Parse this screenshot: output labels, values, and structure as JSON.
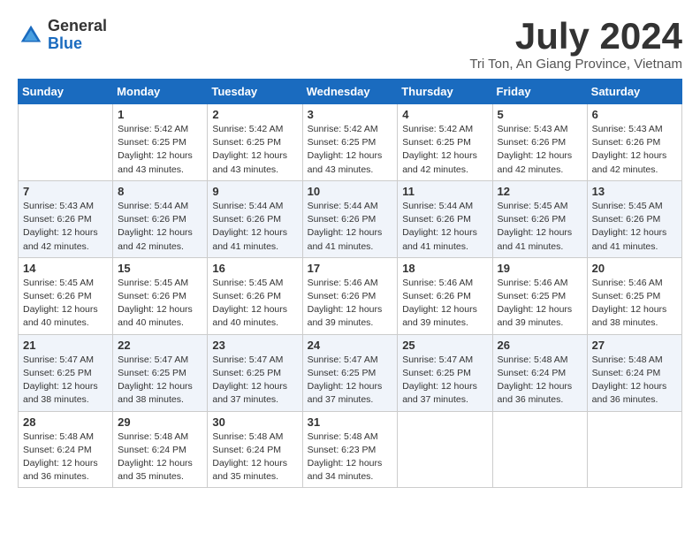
{
  "logo": {
    "general": "General",
    "blue": "Blue"
  },
  "header": {
    "month": "July 2024",
    "location": "Tri Ton, An Giang Province, Vietnam"
  },
  "days_of_week": [
    "Sunday",
    "Monday",
    "Tuesday",
    "Wednesday",
    "Thursday",
    "Friday",
    "Saturday"
  ],
  "weeks": [
    [
      {
        "day": "",
        "info": ""
      },
      {
        "day": "1",
        "info": "Sunrise: 5:42 AM\nSunset: 6:25 PM\nDaylight: 12 hours\nand 43 minutes."
      },
      {
        "day": "2",
        "info": "Sunrise: 5:42 AM\nSunset: 6:25 PM\nDaylight: 12 hours\nand 43 minutes."
      },
      {
        "day": "3",
        "info": "Sunrise: 5:42 AM\nSunset: 6:25 PM\nDaylight: 12 hours\nand 43 minutes."
      },
      {
        "day": "4",
        "info": "Sunrise: 5:42 AM\nSunset: 6:25 PM\nDaylight: 12 hours\nand 42 minutes."
      },
      {
        "day": "5",
        "info": "Sunrise: 5:43 AM\nSunset: 6:26 PM\nDaylight: 12 hours\nand 42 minutes."
      },
      {
        "day": "6",
        "info": "Sunrise: 5:43 AM\nSunset: 6:26 PM\nDaylight: 12 hours\nand 42 minutes."
      }
    ],
    [
      {
        "day": "7",
        "info": "Sunrise: 5:43 AM\nSunset: 6:26 PM\nDaylight: 12 hours\nand 42 minutes."
      },
      {
        "day": "8",
        "info": "Sunrise: 5:44 AM\nSunset: 6:26 PM\nDaylight: 12 hours\nand 42 minutes."
      },
      {
        "day": "9",
        "info": "Sunrise: 5:44 AM\nSunset: 6:26 PM\nDaylight: 12 hours\nand 41 minutes."
      },
      {
        "day": "10",
        "info": "Sunrise: 5:44 AM\nSunset: 6:26 PM\nDaylight: 12 hours\nand 41 minutes."
      },
      {
        "day": "11",
        "info": "Sunrise: 5:44 AM\nSunset: 6:26 PM\nDaylight: 12 hours\nand 41 minutes."
      },
      {
        "day": "12",
        "info": "Sunrise: 5:45 AM\nSunset: 6:26 PM\nDaylight: 12 hours\nand 41 minutes."
      },
      {
        "day": "13",
        "info": "Sunrise: 5:45 AM\nSunset: 6:26 PM\nDaylight: 12 hours\nand 41 minutes."
      }
    ],
    [
      {
        "day": "14",
        "info": "Sunrise: 5:45 AM\nSunset: 6:26 PM\nDaylight: 12 hours\nand 40 minutes."
      },
      {
        "day": "15",
        "info": "Sunrise: 5:45 AM\nSunset: 6:26 PM\nDaylight: 12 hours\nand 40 minutes."
      },
      {
        "day": "16",
        "info": "Sunrise: 5:45 AM\nSunset: 6:26 PM\nDaylight: 12 hours\nand 40 minutes."
      },
      {
        "day": "17",
        "info": "Sunrise: 5:46 AM\nSunset: 6:26 PM\nDaylight: 12 hours\nand 39 minutes."
      },
      {
        "day": "18",
        "info": "Sunrise: 5:46 AM\nSunset: 6:26 PM\nDaylight: 12 hours\nand 39 minutes."
      },
      {
        "day": "19",
        "info": "Sunrise: 5:46 AM\nSunset: 6:25 PM\nDaylight: 12 hours\nand 39 minutes."
      },
      {
        "day": "20",
        "info": "Sunrise: 5:46 AM\nSunset: 6:25 PM\nDaylight: 12 hours\nand 38 minutes."
      }
    ],
    [
      {
        "day": "21",
        "info": "Sunrise: 5:47 AM\nSunset: 6:25 PM\nDaylight: 12 hours\nand 38 minutes."
      },
      {
        "day": "22",
        "info": "Sunrise: 5:47 AM\nSunset: 6:25 PM\nDaylight: 12 hours\nand 38 minutes."
      },
      {
        "day": "23",
        "info": "Sunrise: 5:47 AM\nSunset: 6:25 PM\nDaylight: 12 hours\nand 37 minutes."
      },
      {
        "day": "24",
        "info": "Sunrise: 5:47 AM\nSunset: 6:25 PM\nDaylight: 12 hours\nand 37 minutes."
      },
      {
        "day": "25",
        "info": "Sunrise: 5:47 AM\nSunset: 6:25 PM\nDaylight: 12 hours\nand 37 minutes."
      },
      {
        "day": "26",
        "info": "Sunrise: 5:48 AM\nSunset: 6:24 PM\nDaylight: 12 hours\nand 36 minutes."
      },
      {
        "day": "27",
        "info": "Sunrise: 5:48 AM\nSunset: 6:24 PM\nDaylight: 12 hours\nand 36 minutes."
      }
    ],
    [
      {
        "day": "28",
        "info": "Sunrise: 5:48 AM\nSunset: 6:24 PM\nDaylight: 12 hours\nand 36 minutes."
      },
      {
        "day": "29",
        "info": "Sunrise: 5:48 AM\nSunset: 6:24 PM\nDaylight: 12 hours\nand 35 minutes."
      },
      {
        "day": "30",
        "info": "Sunrise: 5:48 AM\nSunset: 6:24 PM\nDaylight: 12 hours\nand 35 minutes."
      },
      {
        "day": "31",
        "info": "Sunrise: 5:48 AM\nSunset: 6:23 PM\nDaylight: 12 hours\nand 34 minutes."
      },
      {
        "day": "",
        "info": ""
      },
      {
        "day": "",
        "info": ""
      },
      {
        "day": "",
        "info": ""
      }
    ]
  ]
}
